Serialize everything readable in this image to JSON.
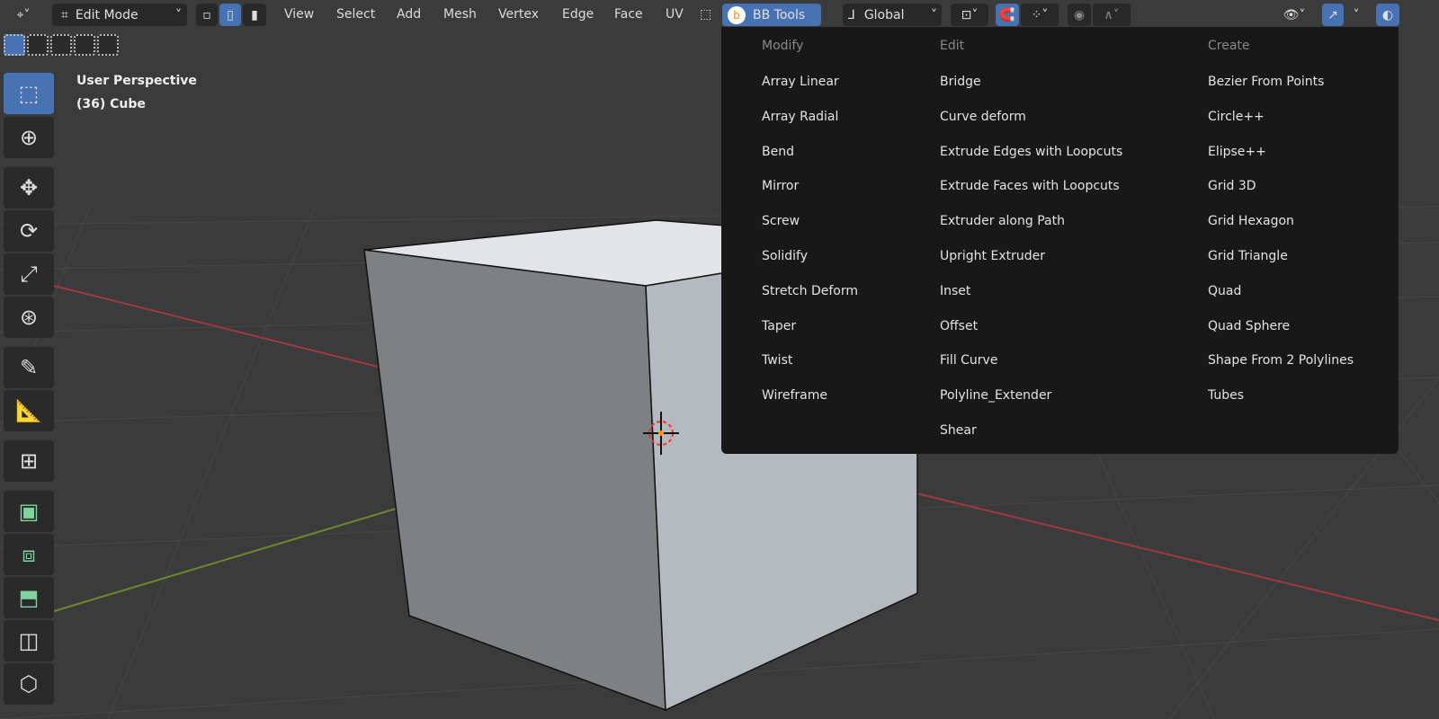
{
  "header": {
    "mode": "Edit Mode",
    "menus": [
      "View",
      "Select",
      "Add",
      "Mesh",
      "Vertex",
      "Edge",
      "Face",
      "UV"
    ],
    "addon_tab": "BB Tools",
    "transform_orientation": "Global"
  },
  "viewport": {
    "view_name": "User Perspective",
    "object_info": "(36) Cube"
  },
  "toolbar": {
    "icons": [
      "select-box-icon",
      "cursor-icon",
      "move-icon",
      "rotate-icon",
      "scale-icon",
      "transform-icon",
      "annotate-icon",
      "measure-icon",
      "add-cube-icon",
      "extrude-icon",
      "inset-icon",
      "bevel-icon",
      "loop-cut-icon",
      "knife-icon"
    ]
  },
  "bb_menu": {
    "columns": [
      {
        "heading": "Modify",
        "items": [
          "Array Linear",
          "Array Radial",
          "Bend",
          "Mirror",
          "Screw",
          "Solidify",
          "Stretch Deform",
          "Taper",
          "Twist",
          "Wireframe"
        ]
      },
      {
        "heading": "Edit",
        "items": [
          "Bridge",
          "Curve deform",
          "Extrude Edges with Loopcuts",
          "Extrude Faces with Loopcuts",
          "Extruder along Path",
          "Upright Extruder",
          "Inset",
          "Offset",
          "Fill Curve",
          "Polyline_Extender",
          "Shear"
        ]
      },
      {
        "heading": "Create",
        "items": [
          "Bezier From Points",
          "Circle++",
          "Elipse++",
          "Grid 3D",
          "Grid Hexagon",
          "Grid Triangle",
          "Quad",
          "Quad Sphere",
          "Shape From 2 Polylines",
          "Tubes"
        ]
      }
    ]
  },
  "colors": {
    "accent": "#4772b3",
    "menu_bg": "#181818",
    "viewport_bg": "#3b3b3b",
    "x_axis": "#b04040",
    "y_axis": "#6a8a2a"
  }
}
